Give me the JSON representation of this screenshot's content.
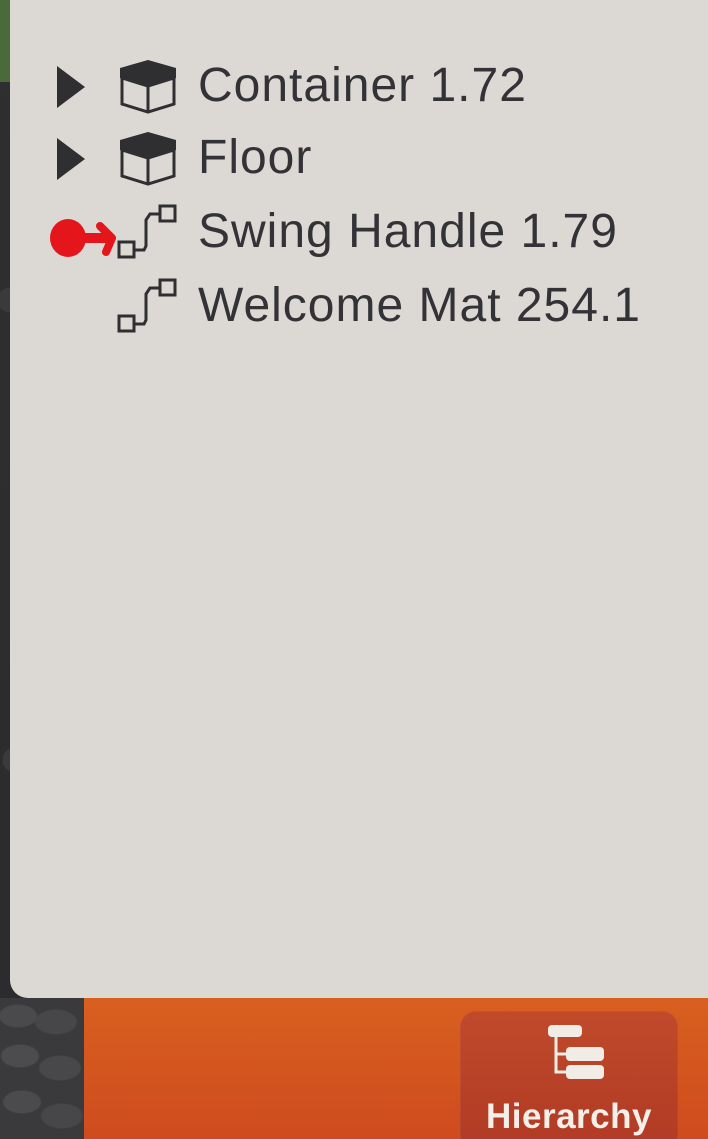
{
  "hierarchy": {
    "items": [
      {
        "label": "Container 1.72",
        "icon": "box-icon",
        "expandable": true
      },
      {
        "label": "Floor",
        "icon": "box-icon",
        "expandable": true
      },
      {
        "label": "Swing Handle 1.79",
        "icon": "link-node-icon",
        "expandable": false
      },
      {
        "label": "Welcome Mat 254.1",
        "icon": "link-node-icon",
        "expandable": false
      }
    ]
  },
  "toolbar": {
    "hierarchy_label": "Hierarchy",
    "hierarchy_icon": "hierarchy-tree-icon"
  },
  "colors": {
    "panel_bg": "#dcd9d5",
    "text": "#333236",
    "bar_orange": "#d8601f",
    "button_bg": "#b8432a",
    "marker_red": "#e4161b"
  }
}
